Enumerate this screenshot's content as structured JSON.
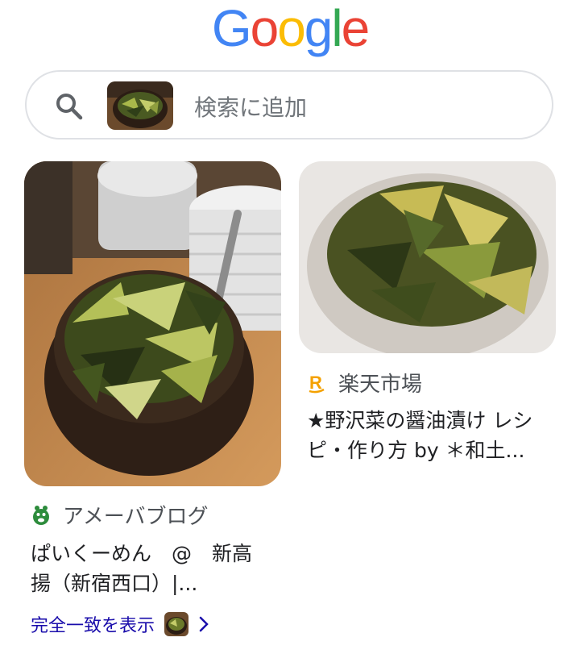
{
  "header": {
    "logo_letters": [
      "G",
      "o",
      "o",
      "g",
      "l",
      "e"
    ],
    "logo_colors": [
      "#4285F4",
      "#EA4335",
      "#FBBC05",
      "#4285F4",
      "#34A853",
      "#EA4335"
    ]
  },
  "search": {
    "placeholder": "検索に追加",
    "search_icon": "search-icon",
    "thumbnail": "query-image-pickled-greens"
  },
  "results": [
    {
      "image": "pickled-greens-dark-bowl",
      "source_icon": "ameba-icon",
      "source": "アメーバブログ",
      "title_line1": "ぱいくーめん　@　新高",
      "title_line2": "揚（新宿西口）|..."
    },
    {
      "image": "pickled-greens-white-bowl",
      "source_icon": "rakuten-icon",
      "source": "楽天市場",
      "title_line1": "★野沢菜の醤油漬け レシ",
      "title_line2": "ピ・作り方 by ＊和土..."
    }
  ],
  "footer": {
    "exact_match_label": "完全一致を表示",
    "chevron": "chevron-right-icon"
  }
}
